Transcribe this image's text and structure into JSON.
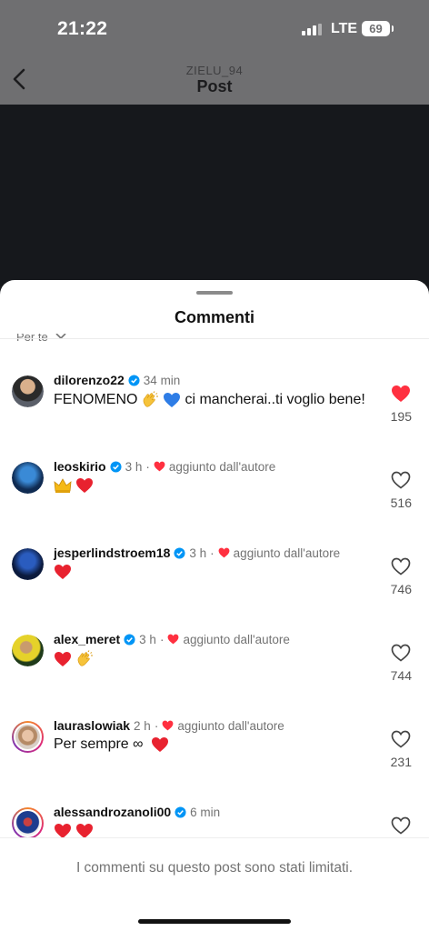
{
  "status": {
    "time": "21:22",
    "network": "LTE",
    "battery": "69"
  },
  "nav": {
    "username": "ZIELU_94",
    "title": "Post"
  },
  "sheet": {
    "title": "Commenti",
    "sort_label": "Per te"
  },
  "comments": [
    {
      "user": "dilorenzo22",
      "verified": true,
      "time": "34 min",
      "author_liked": false,
      "author_liked_label": "",
      "text": "FENOMENO",
      "text_after": "ci mancherai..ti voglio bene!",
      "likes": "195",
      "liked": true
    },
    {
      "user": "leoskirio",
      "verified": true,
      "time": "3 h",
      "author_liked": true,
      "author_liked_label": "aggiunto dall'autore",
      "text": "",
      "likes": "516",
      "liked": false
    },
    {
      "user": "jesperlindstroem18",
      "verified": true,
      "time": "3 h",
      "author_liked": true,
      "author_liked_label": "aggiunto dall'autore",
      "text": "",
      "likes": "746",
      "liked": false
    },
    {
      "user": "alex_meret",
      "verified": true,
      "time": "3 h",
      "author_liked": true,
      "author_liked_label": "aggiunto dall'autore",
      "text": "",
      "likes": "744",
      "liked": false
    },
    {
      "user": "lauraslowiak",
      "verified": false,
      "time": "2 h",
      "author_liked": true,
      "author_liked_label": "aggiunto dall'autore",
      "text": "Per sempre ∞",
      "likes": "231",
      "liked": false
    },
    {
      "user": "alessandrozanoli00",
      "verified": true,
      "time": "6 min",
      "author_liked": false,
      "author_liked_label": "",
      "text": "",
      "likes": "",
      "liked": false
    }
  ],
  "footer": {
    "text": "I commenti su questo post sono stati limitati."
  },
  "colors": {
    "like_red": "#ff3040",
    "verified_blue": "#0095f6",
    "secondary_text": "#737373"
  }
}
